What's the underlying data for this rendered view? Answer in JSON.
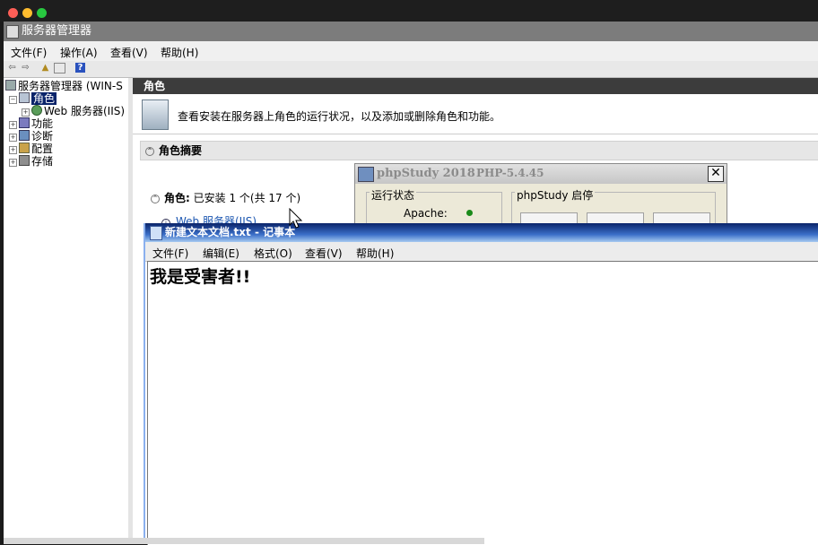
{
  "server_manager": {
    "title": "服务器管理器",
    "menu": [
      "文件(F)",
      "操作(A)",
      "查看(V)",
      "帮助(H)"
    ],
    "tree": {
      "root": "服务器管理器 (WIN-S",
      "roles": "角色",
      "web_iis": "Web 服务器(IIS)",
      "features": "功能",
      "diagnostics": "诊断",
      "config": "配置",
      "storage": "存储"
    },
    "main": {
      "header": "角色",
      "description": "查看安装在服务器上角色的运行状况，以及添加或删除角色和功能。",
      "summary_title": "角色摘要",
      "roles_label": "角色:",
      "roles_status": "已安装 1 个(共 17 个)",
      "iis_link": "Web 服务器(IIS)"
    }
  },
  "phpstudy": {
    "title": "phpStudy 2018",
    "version": "PHP-5.4.45",
    "close": "✕",
    "status_group": "运行状态",
    "apache_label": "Apache:",
    "start_group": "phpStudy 启停",
    "status_color": "#1a8a1a"
  },
  "notepad": {
    "title": "新建文本文档.txt - 记事本",
    "menu": [
      "文件(F)",
      "编辑(E)",
      "格式(O)",
      "查看(V)",
      "帮助(H)"
    ],
    "content": "我是受害者!!"
  }
}
